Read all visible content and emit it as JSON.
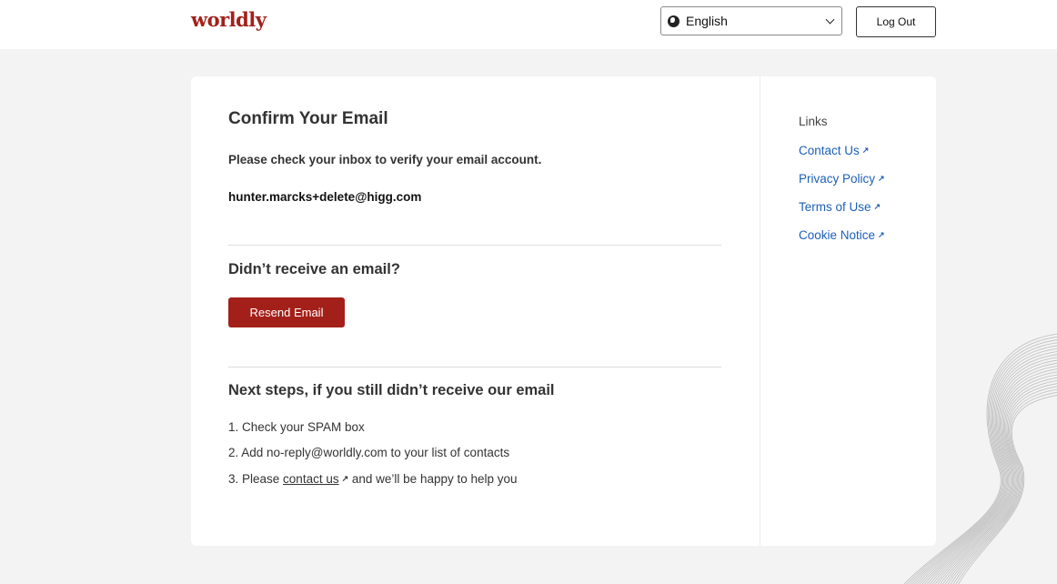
{
  "header": {
    "logo": "worldly",
    "language": "English",
    "logout_label": "Log Out"
  },
  "main": {
    "title": "Confirm Your Email",
    "instructions": "Please check your inbox to verify your email account.",
    "email": "hunter.marcks+delete@higg.com",
    "resend_heading": "Didn’t receive an email?",
    "resend_label": "Resend Email",
    "next_heading": "Next steps, if you still didn’t receive our email",
    "steps": {
      "one": "1. Check your SPAM box",
      "two": "2. Add no-reply@worldly.com to your list of contacts",
      "three_prefix": "3. Please ",
      "three_link": "contact us",
      "three_suffix": " and we’ll be happy to help you"
    }
  },
  "sidebar": {
    "heading": "Links",
    "items": [
      {
        "label": "Contact Us"
      },
      {
        "label": "Privacy Policy"
      },
      {
        "label": "Terms of Use"
      },
      {
        "label": "Cookie Notice"
      }
    ]
  },
  "icons": {
    "language": "globe-icon",
    "dropdown": "chevron-down-icon",
    "external": "external-link-icon"
  },
  "colors": {
    "brand": "#a3201a",
    "link": "#1c5fb8",
    "background": "#f3f3f3"
  }
}
